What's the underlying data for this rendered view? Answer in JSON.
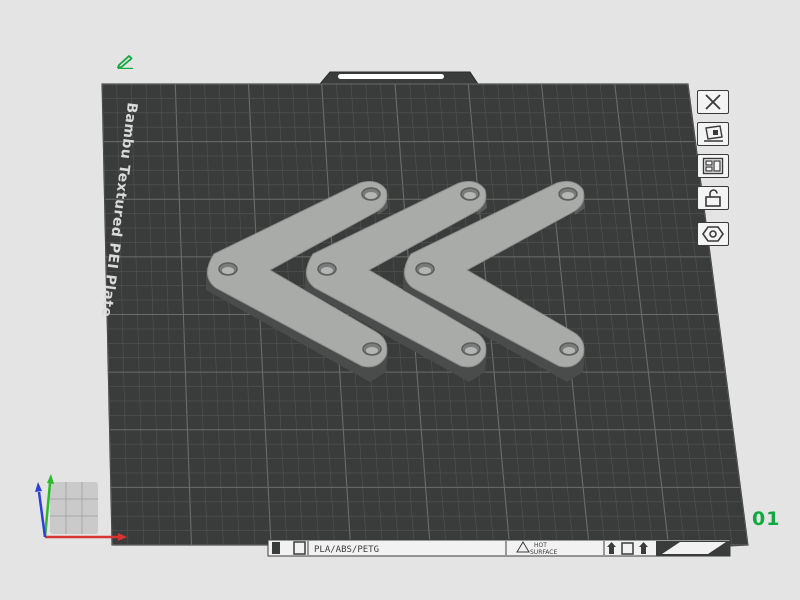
{
  "plate": {
    "name": "Bambu Textured PEI Plate",
    "number": "01",
    "filament_label": "PLA/ABS/PETG",
    "hot_surface_line1": "HOT",
    "hot_surface_line2": "SURFACE"
  },
  "toolbar": {
    "buttons": [
      {
        "name": "remove-plate",
        "icon": "close-icon"
      },
      {
        "name": "auto-orient",
        "icon": "orient-icon"
      },
      {
        "name": "arrange",
        "icon": "arrange-icon"
      },
      {
        "name": "lock-plate",
        "icon": "unlock-icon"
      },
      {
        "name": "plate-settings",
        "icon": "hexagon-settings-icon"
      }
    ]
  },
  "model": {
    "description_icon": "v-bracket-parts",
    "count": 3,
    "color": "#a9aba9"
  },
  "colors": {
    "plate_surface": "#3a3c3b",
    "grid_line": "#5b5d5c",
    "background": "#e4e4e4",
    "accent_green": "#0eaa3f",
    "axis_x": "#d83434",
    "axis_y": "#2eb82e",
    "axis_z": "#2f3fd8"
  }
}
